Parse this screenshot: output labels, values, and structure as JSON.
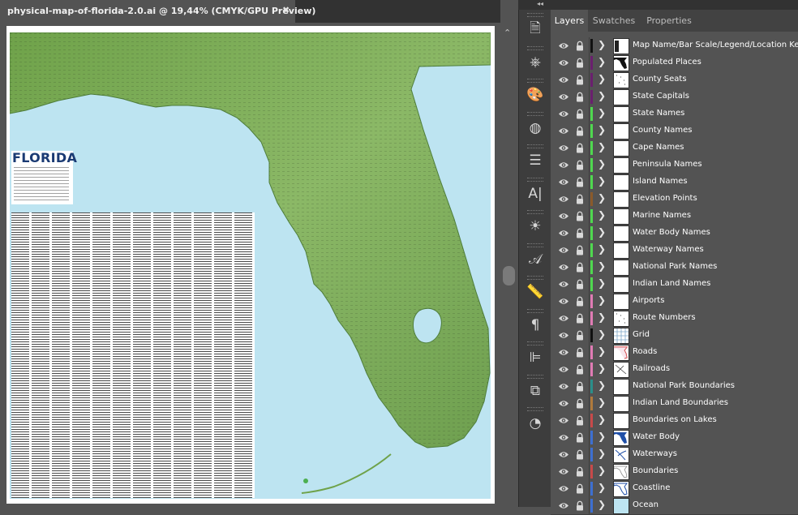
{
  "document": {
    "tab_title": "physical-map-of-florida-2.0.ai @ 19,44% (CMYK/GPU Preview)",
    "close_glyph": "✖"
  },
  "map": {
    "title": "FLORIDA",
    "colors": {
      "water": "#bde4f1",
      "land": "#7fae5b",
      "land_dark": "#5f8f3e",
      "lake": "#bde4f1"
    }
  },
  "scrollbar": {
    "up_glyph": "⌃"
  },
  "tools": {
    "collapse_glyph": "◂◂",
    "buttons": [
      {
        "name": "document-info-icon",
        "glyph": "🗎"
      },
      {
        "name": "navigator-icon",
        "glyph": "⎈"
      },
      {
        "name": "color-palette-icon",
        "glyph": "🎨"
      },
      {
        "name": "appearance-icon",
        "glyph": "◍"
      },
      {
        "name": "stroke-icon",
        "glyph": "☰"
      },
      {
        "name": "character-icon",
        "glyph": "A|"
      },
      {
        "name": "brightness-icon",
        "glyph": "☀"
      },
      {
        "name": "type-icon",
        "glyph": "𝒜"
      },
      {
        "name": "ruler-icon",
        "glyph": "📏"
      },
      {
        "name": "paragraph-icon",
        "glyph": "¶"
      },
      {
        "name": "align-icon",
        "glyph": "⊫"
      },
      {
        "name": "transform-icon",
        "glyph": "⧉"
      },
      {
        "name": "pathfinder-icon",
        "glyph": "◔"
      }
    ]
  },
  "panel": {
    "tabs": [
      "Layers",
      "Swatches",
      "Properties"
    ],
    "active_tab": "Layers",
    "layers": [
      {
        "name": "Map Name/Bar Scale/Legend/Location Key",
        "color": "#111111",
        "thumb": "legend"
      },
      {
        "name": "Populated Places",
        "color": "#6a1f6e",
        "thumb": "florida"
      },
      {
        "name": "County Seats",
        "color": "#6a1f6e",
        "thumb": "dots"
      },
      {
        "name": "State Capitals",
        "color": "#6a1f6e",
        "thumb": "blank"
      },
      {
        "name": "State Names",
        "color": "#4fd84f",
        "thumb": "blank"
      },
      {
        "name": "County Names",
        "color": "#4fd84f",
        "thumb": "blank"
      },
      {
        "name": "Cape Names",
        "color": "#4fd84f",
        "thumb": "blank"
      },
      {
        "name": "Peninsula Names",
        "color": "#4fd84f",
        "thumb": "blank"
      },
      {
        "name": "Island Names",
        "color": "#4fd84f",
        "thumb": "blank"
      },
      {
        "name": "Elevation Points",
        "color": "#8a5a2b",
        "thumb": "blank"
      },
      {
        "name": "Marine Names",
        "color": "#4fd84f",
        "thumb": "blank"
      },
      {
        "name": "Water Body Names",
        "color": "#4fd84f",
        "thumb": "blank"
      },
      {
        "name": "Waterway Names",
        "color": "#4fd84f",
        "thumb": "blank"
      },
      {
        "name": "National Park Names",
        "color": "#4fd84f",
        "thumb": "blank"
      },
      {
        "name": "Indian Land Names",
        "color": "#4fd84f",
        "thumb": "blank"
      },
      {
        "name": "Airports",
        "color": "#e07bb4",
        "thumb": "blank"
      },
      {
        "name": "Route Numbers",
        "color": "#e07bb4",
        "thumb": "dots"
      },
      {
        "name": "Grid",
        "color": "#111111",
        "thumb": "grid"
      },
      {
        "name": "Roads",
        "color": "#e07bb4",
        "thumb": "roads"
      },
      {
        "name": "Railroads",
        "color": "#e07bb4",
        "thumb": "rail"
      },
      {
        "name": "National Park Boundaries",
        "color": "#2a8f8a",
        "thumb": "blank"
      },
      {
        "name": "Indian Land Boundaries",
        "color": "#b07a3c",
        "thumb": "blank"
      },
      {
        "name": "Boundaries on Lakes",
        "color": "#c84a4a",
        "thumb": "blank"
      },
      {
        "name": "Water Body",
        "color": "#3d6fd1",
        "thumb": "water"
      },
      {
        "name": "Waterways",
        "color": "#3d6fd1",
        "thumb": "waterways"
      },
      {
        "name": "Boundaries",
        "color": "#c84a4a",
        "thumb": "bounds"
      },
      {
        "name": "Coastline",
        "color": "#3d6fd1",
        "thumb": "coast"
      },
      {
        "name": "Ocean",
        "color": "#3d6fd1",
        "thumb": "ocean"
      }
    ]
  }
}
